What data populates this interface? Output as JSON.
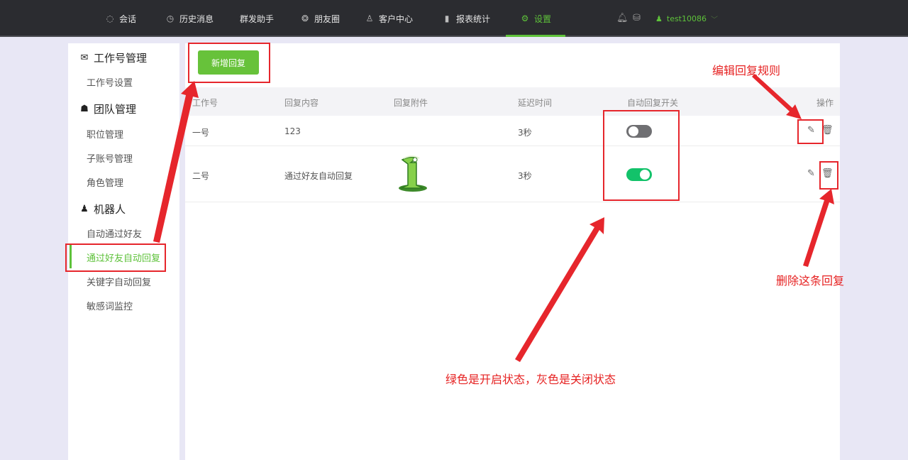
{
  "nav": {
    "items": [
      {
        "label": "会话",
        "icon": "chat-icon"
      },
      {
        "label": "历史消息",
        "icon": "clock-icon"
      },
      {
        "label": "群发助手",
        "icon": ""
      },
      {
        "label": "朋友圈",
        "icon": "moments-icon"
      },
      {
        "label": "客户中心",
        "icon": "user-icon"
      },
      {
        "label": "报表统计",
        "icon": "bar-chart-icon"
      },
      {
        "label": "设置",
        "icon": "gear-icon"
      }
    ],
    "active": "设置",
    "username": "test10086"
  },
  "sidebar": {
    "groups": [
      {
        "title": "工作号管理",
        "icon": "wechat-icon",
        "items": [
          "工作号设置"
        ]
      },
      {
        "title": "团队管理",
        "icon": "team-icon",
        "items": [
          "职位管理",
          "子账号管理",
          "角色管理"
        ]
      },
      {
        "title": "机器人",
        "icon": "robot-icon",
        "items": [
          "自动通过好友",
          "通过好友自动回复",
          "关键字自动回复",
          "敏感词监控"
        ]
      }
    ],
    "active_item": "通过好友自动回复"
  },
  "main": {
    "add_button": "新增回复",
    "table": {
      "headers": [
        "工作号",
        "回复内容",
        "回复附件",
        "延迟时间",
        "自动回复开关",
        "操作"
      ],
      "rows": [
        {
          "account": "一号",
          "content": "123",
          "attachment": "",
          "delay": "3秒",
          "auto_reply": false
        },
        {
          "account": "二号",
          "content": "通过好友自动回复",
          "attachment": "image",
          "delay": "3秒",
          "auto_reply": true
        }
      ]
    }
  },
  "annotations": {
    "edit_rule": "编辑回复规则",
    "delete_reply": "删除这条回复",
    "toggle_note": "绿色是开启状态，灰色是关闭状态"
  },
  "colors": {
    "accent": "#5ec23a",
    "button": "#67c23a",
    "toggle_on": "#13c26a",
    "toggle_off": "#6f6f72",
    "annotation": "#e6262c"
  }
}
